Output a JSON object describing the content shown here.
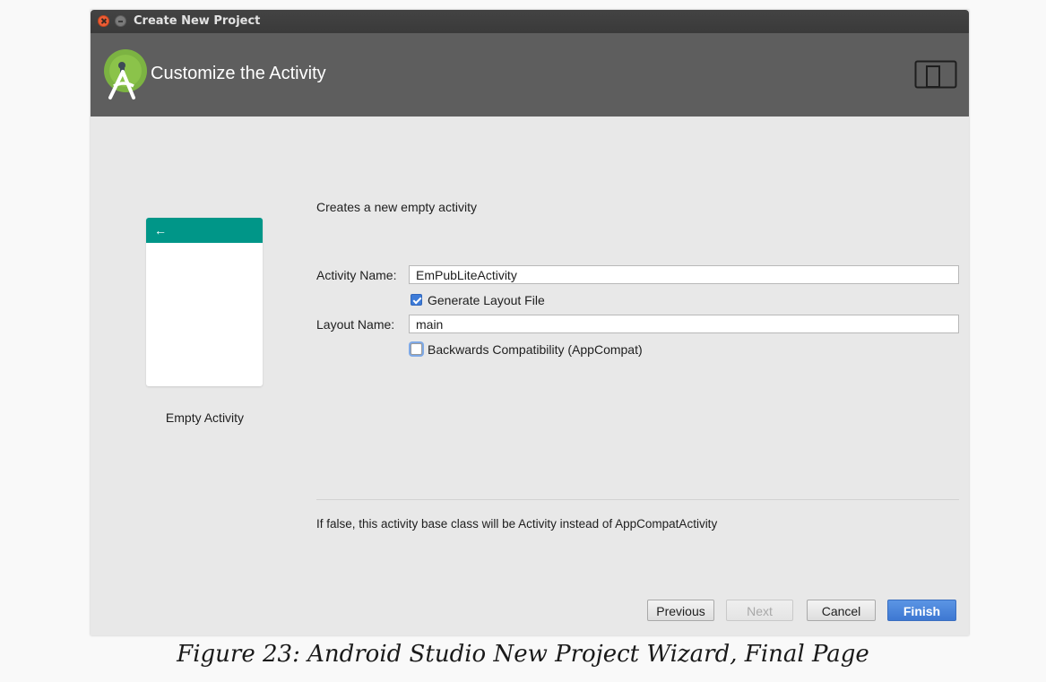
{
  "window": {
    "title": "Create New Project"
  },
  "header": {
    "title": "Customize the Activity",
    "logo_icon": "android-studio-logo-icon",
    "device_icon": "device-preview-icon"
  },
  "preview": {
    "back_icon": "←",
    "template_name": "Empty Activity",
    "toolbar_color": "#009688"
  },
  "form": {
    "description": "Creates a new empty activity",
    "activity_name_label": "Activity Name:",
    "activity_name_value": "EmPubLiteActivity",
    "generate_layout_label": "Generate Layout File",
    "generate_layout_checked": true,
    "layout_name_label": "Layout Name:",
    "layout_name_value": "main",
    "backwards_compat_label": "Backwards Compatibility (AppCompat)",
    "backwards_compat_checked": false
  },
  "hint": "If false, this activity base class will be Activity instead of AppCompatActivity",
  "buttons": {
    "previous": "Previous",
    "next": "Next",
    "cancel": "Cancel",
    "finish": "Finish"
  },
  "caption": "Figure 23: Android Studio New Project Wizard, Final Page"
}
